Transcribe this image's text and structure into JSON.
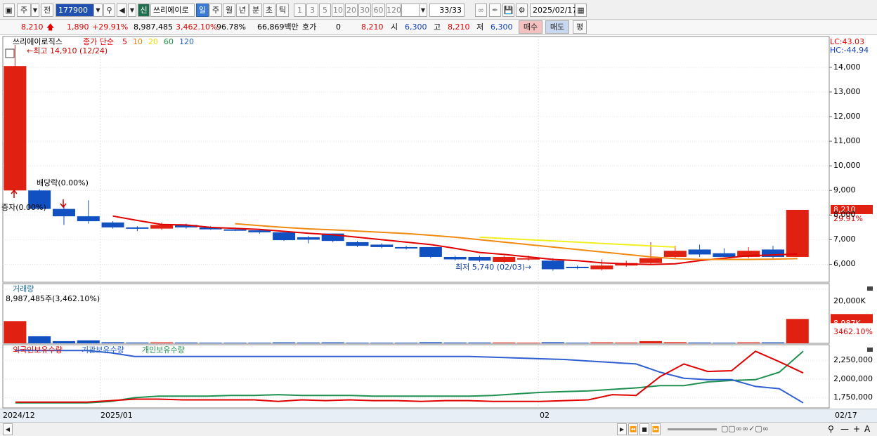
{
  "toolbar": {
    "market": "주",
    "tab_prev": "전",
    "code": "177900",
    "shin": "신",
    "stock_name": "쓰리에이로",
    "periods": [
      "일",
      "주",
      "월",
      "년",
      "분",
      "초",
      "틱"
    ],
    "active_period": "일",
    "intervals": [
      "1",
      "3",
      "5",
      "10",
      "20",
      "30",
      "60",
      "120"
    ],
    "count": "33/33",
    "date": "2025/02/17"
  },
  "quote": {
    "price": "8,210",
    "change": "1,890",
    "change_pct": "+29.91%",
    "volume": "8,987,485",
    "volume_ratio": "3,462.10%",
    "turnover": "96.78%",
    "amount": "66,869백만",
    "hoga_label": "호가",
    "hoga_value": "0",
    "hoga_price": "8,210",
    "open_label": "시",
    "open": "6,300",
    "high_label": "고",
    "high": "8,210",
    "low_label": "저",
    "low": "6,300",
    "buy_button": "매수",
    "sell_button": "매도",
    "eval_button": "평"
  },
  "price_panel": {
    "title": "쓰리에이로직스",
    "ma_label": "종가 단순",
    "ma_periods": [
      {
        "label": "5",
        "color": "#e00000"
      },
      {
        "label": "10",
        "color": "#f08000"
      },
      {
        "label": "20",
        "color": "#e8e000"
      },
      {
        "label": "60",
        "color": "#209040"
      },
      {
        "label": "120",
        "color": "#2060c0"
      }
    ],
    "lc": "LC:43.03",
    "hc": "HC:-44.94",
    "high_note": "최고 14,910 (12/24)",
    "low_note": "최저 5,740 (02/03)",
    "dividend_note": "배당락(0.00%)",
    "increase_note": "증자(0.00%)",
    "last_price_tag": "8,210",
    "last_pct_tag": "29.91%",
    "y_ticks": [
      "14,000",
      "13,000",
      "12,000",
      "11,000",
      "10,000",
      "9,000",
      "8,000",
      "7,000",
      "6,000"
    ]
  },
  "volume_panel": {
    "title": "거래량",
    "note": "8,987,485주(3,462.10%)",
    "y_tick": "20,000K",
    "last_tag": "8,987K",
    "last_pct_tag": "3462.10%"
  },
  "holding_panel": {
    "series": [
      {
        "name": "외국인보유수량",
        "color": "#e00000"
      },
      {
        "name": "기관보유수량",
        "color": "#2060d0"
      },
      {
        "name": "개인보유수량",
        "color": "#209050"
      }
    ],
    "y_ticks": [
      "2,250,000",
      "2,000,000",
      "1,750,000"
    ]
  },
  "x_axis": {
    "labels": [
      "2024/12",
      "2025/01",
      "02"
    ],
    "right_label": "02/17"
  },
  "chart_data": {
    "type": "candlestick",
    "price_ylim": [
      5500,
      14910
    ],
    "candles": [
      {
        "o": 9000,
        "h": 14910,
        "l": 9000,
        "c": 14050
      },
      {
        "o": 9000,
        "h": 9050,
        "l": 8250,
        "c": 8250
      },
      {
        "o": 8250,
        "h": 8400,
        "l": 7600,
        "c": 7950
      },
      {
        "o": 7950,
        "h": 8600,
        "l": 7650,
        "c": 7750
      },
      {
        "o": 7700,
        "h": 7750,
        "l": 7450,
        "c": 7500
      },
      {
        "o": 7500,
        "h": 7550,
        "l": 7350,
        "c": 7450
      },
      {
        "o": 7450,
        "h": 7700,
        "l": 7400,
        "c": 7600
      },
      {
        "o": 7600,
        "h": 7650,
        "l": 7450,
        "c": 7500
      },
      {
        "o": 7500,
        "h": 7550,
        "l": 7400,
        "c": 7420
      },
      {
        "o": 7420,
        "h": 7500,
        "l": 7350,
        "c": 7380
      },
      {
        "o": 7380,
        "h": 7400,
        "l": 7250,
        "c": 7300
      },
      {
        "o": 7300,
        "h": 7300,
        "l": 6950,
        "c": 6980
      },
      {
        "o": 7100,
        "h": 7150,
        "l": 6850,
        "c": 7000
      },
      {
        "o": 7250,
        "h": 7250,
        "l": 6900,
        "c": 6950
      },
      {
        "o": 6900,
        "h": 6950,
        "l": 6700,
        "c": 6750
      },
      {
        "o": 6800,
        "h": 6850,
        "l": 6650,
        "c": 6700
      },
      {
        "o": 6700,
        "h": 6750,
        "l": 6600,
        "c": 6650
      },
      {
        "o": 6700,
        "h": 6700,
        "l": 6250,
        "c": 6300
      },
      {
        "o": 6300,
        "h": 6350,
        "l": 6150,
        "c": 6200
      },
      {
        "o": 6300,
        "h": 6350,
        "l": 6100,
        "c": 6150
      },
      {
        "o": 6100,
        "h": 6350,
        "l": 6050,
        "c": 6300
      },
      {
        "o": 6250,
        "h": 6350,
        "l": 6150,
        "c": 6250
      },
      {
        "o": 6150,
        "h": 6250,
        "l": 5740,
        "c": 5800
      },
      {
        "o": 5900,
        "h": 5950,
        "l": 5800,
        "c": 5850
      },
      {
        "o": 5800,
        "h": 6200,
        "l": 5750,
        "c": 5950
      },
      {
        "o": 5950,
        "h": 6150,
        "l": 5900,
        "c": 6050
      },
      {
        "o": 6050,
        "h": 6900,
        "l": 6000,
        "c": 6250
      },
      {
        "o": 6300,
        "h": 6750,
        "l": 6250,
        "c": 6550
      },
      {
        "o": 6600,
        "h": 6800,
        "l": 6300,
        "c": 6400
      },
      {
        "o": 6450,
        "h": 6650,
        "l": 6300,
        "c": 6300
      },
      {
        "o": 6300,
        "h": 6700,
        "l": 6250,
        "c": 6550
      },
      {
        "o": 6600,
        "h": 6750,
        "l": 6250,
        "c": 6300
      },
      {
        "o": 6300,
        "h": 8210,
        "l": 6300,
        "c": 8210
      }
    ],
    "ma5": [
      null,
      null,
      null,
      null,
      7960,
      7780,
      7620,
      7600,
      7500,
      7460,
      7420,
      7340,
      7260,
      7200,
      7100,
      7000,
      6900,
      6800,
      6650,
      6480,
      6400,
      6300,
      6200,
      6150,
      6060,
      6020,
      5990,
      6020,
      6150,
      6250,
      6350,
      6380,
      6420
    ],
    "ma10": [
      null,
      null,
      null,
      null,
      null,
      null,
      null,
      null,
      null,
      7650,
      7570,
      7500,
      7440,
      7400,
      7350,
      7300,
      7250,
      7180,
      7100,
      7000,
      6900,
      6800,
      6700,
      6600,
      6500,
      6400,
      6300,
      6230,
      6200,
      6200,
      6200,
      6210,
      6230
    ],
    "ma20": [
      null,
      null,
      null,
      null,
      null,
      null,
      null,
      null,
      null,
      null,
      null,
      null,
      null,
      null,
      null,
      null,
      null,
      null,
      null,
      7100,
      7050,
      7000,
      6950,
      6900,
      6850,
      6800,
      6750,
      6700
    ],
    "volume_ylim": [
      0,
      22000000
    ],
    "volume": [
      8200000,
      2600000,
      800000,
      1100000,
      400000,
      300000,
      350000,
      300000,
      250000,
      250000,
      250000,
      350000,
      300000,
      350000,
      250000,
      250000,
      250000,
      400000,
      300000,
      300000,
      300000,
      250000,
      400000,
      250000,
      350000,
      300000,
      800000,
      400000,
      300000,
      250000,
      350000,
      350000,
      8987485
    ],
    "holding_ylim": [
      1650000,
      2420000
    ],
    "foreign": [
      1690000,
      1690000,
      1690000,
      1690000,
      1710000,
      1730000,
      1730000,
      1720000,
      1720000,
      1720000,
      1720000,
      1700000,
      1720000,
      1710000,
      1720000,
      1710000,
      1710000,
      1700000,
      1710000,
      1710000,
      1700000,
      1700000,
      1700000,
      1710000,
      1720000,
      1790000,
      1780000,
      2030000,
      2200000,
      2100000,
      2110000,
      2370000,
      2230000,
      2080000
    ],
    "institution": [
      2380000,
      2380000,
      2380000,
      2380000,
      2350000,
      2300000,
      2300000,
      2300000,
      2300000,
      2300000,
      2300000,
      2300000,
      2300000,
      2300000,
      2300000,
      2300000,
      2300000,
      2300000,
      2300000,
      2300000,
      2290000,
      2280000,
      2270000,
      2260000,
      2240000,
      2220000,
      2200000,
      2090000,
      2010000,
      1990000,
      1990000,
      1900000,
      1870000,
      1680000
    ],
    "individual": [
      1680000,
      1680000,
      1680000,
      1680000,
      1700000,
      1750000,
      1770000,
      1770000,
      1770000,
      1780000,
      1780000,
      1790000,
      1780000,
      1780000,
      1780000,
      1770000,
      1770000,
      1770000,
      1770000,
      1770000,
      1780000,
      1800000,
      1820000,
      1830000,
      1840000,
      1860000,
      1880000,
      1910000,
      1910000,
      1960000,
      1980000,
      1990000,
      2090000,
      2370000
    ]
  }
}
